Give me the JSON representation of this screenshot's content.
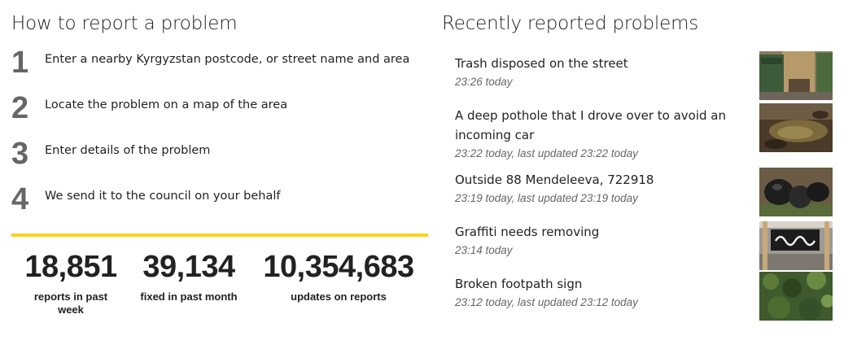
{
  "how": {
    "title": "How to report a problem",
    "steps": [
      {
        "num": "1",
        "text": "Enter a nearby Kyrgyzstan postcode, or street name and area"
      },
      {
        "num": "2",
        "text": "Locate the problem on a map of the area"
      },
      {
        "num": "3",
        "text": "Enter details of the problem"
      },
      {
        "num": "4",
        "text": "We send it to the council on your behalf"
      }
    ]
  },
  "stats": [
    {
      "value": "18,851",
      "label": "reports in past week"
    },
    {
      "value": "39,134",
      "label": "fixed in past month"
    },
    {
      "value": "10,354,683",
      "label": "updates on reports"
    }
  ],
  "recent": {
    "title": "Recently reported problems",
    "items": [
      {
        "title": "Trash disposed on the street",
        "time": "23:26 today",
        "photo": "trash-bins-photo"
      },
      {
        "title": "A deep pothole that I drove over to avoid an incoming car",
        "time": "23:22 today, last updated 23:22 today",
        "photo": "pothole-photo"
      },
      {
        "title": "Outside 88 Mendeleeva, 722918",
        "time": "23:19 today, last updated 23:19 today",
        "photo": "bin-bags-photo"
      },
      {
        "title": "Graffiti needs removing",
        "time": "23:14 today",
        "photo": "graffiti-photo"
      },
      {
        "title": "Broken footpath sign",
        "time": "23:12 today, last updated 23:12 today",
        "photo": "footpath-sign-photo"
      }
    ]
  },
  "colors": {
    "accent": "#fcd214",
    "step_number": "#666666",
    "muted": "#666666"
  }
}
